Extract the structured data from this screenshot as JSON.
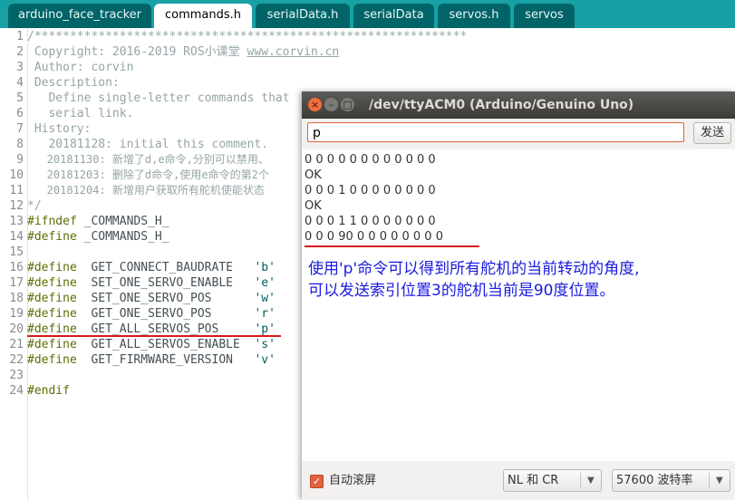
{
  "tabs": [
    "arduino_face_tracker",
    "commands.h",
    "serialData.h",
    "serialData",
    "servos.h",
    "servos"
  ],
  "active_tab": 1,
  "editor": {
    "line_numbers": [
      "1",
      "2",
      "3",
      "4",
      "5",
      "6",
      "7",
      "8",
      "9",
      "10",
      "11",
      "12",
      "13",
      "14",
      "15",
      "16",
      "17",
      "18",
      "19",
      "20",
      "21",
      "22",
      "23",
      "24"
    ],
    "line1": "/*************************************************************",
    "line2_text": " Copyright: 2016-2019 ROS小课堂 ",
    "line2_link": "www.corvin.cn",
    "line3": " Author: corvin",
    "line4": " Description:",
    "line5": "   Define single-letter commands that",
    "line6": "   serial link.",
    "line7": " History:",
    "line8": "   20181128: initial this comment.",
    "line9": "   20181130: 新增了d,e命令,分别可以禁用、",
    "line10": "   20181203: 删除了d命令,使用e命令的第2个",
    "line11": "   20181204: 新增用户获取所有舵机使能状态",
    "line12": "*/",
    "line13_kw": "#ifndef",
    "line13_name": " _COMMANDS_H_",
    "line14_kw": "#define",
    "line14_name": " _COMMANDS_H_",
    "line24_kw": "#endif",
    "defines": [
      {
        "kw": "#define",
        "name": "  GET_CONNECT_BAUDRATE   ",
        "ch": "'b'"
      },
      {
        "kw": "#define",
        "name": "  SET_ONE_SERVO_ENABLE   ",
        "ch": "'e'"
      },
      {
        "kw": "#define",
        "name": "  SET_ONE_SERVO_POS      ",
        "ch": "'w'"
      },
      {
        "kw": "#define",
        "name": "  GET_ONE_SERVO_POS      ",
        "ch": "'r'"
      },
      {
        "kw": "#define",
        "name": "  GET_ALL_SERVOS_POS     ",
        "ch": "'p'"
      },
      {
        "kw": "#define",
        "name": "  GET_ALL_SERVOS_ENABLE  ",
        "ch": "'s'"
      },
      {
        "kw": "#define",
        "name": "  GET_FIRMWARE_VERSION   ",
        "ch": "'v'"
      }
    ]
  },
  "serial": {
    "title": "/dev/ttyACM0 (Arduino/Genuino Uno)",
    "close_glyph": "×",
    "min_glyph": "–",
    "max_glyph": "□",
    "input_value": "p",
    "send_label": "发送",
    "output_lines": [
      "0 0 0 0 0 0 0 0 0 0 0 0",
      "OK",
      "0 0 0 1 0 0 0 0 0 0 0 0",
      "OK",
      "0 0 0 1 1 0 0 0 0 0 0 0",
      "0 0 0 90 0 0 0 0 0 0 0 0"
    ],
    "annotation_line1": "使用'p'命令可以得到所有舵机的当前转动的角度,",
    "annotation_line2": "可以发送索引位置3的舵机当前是90度位置。",
    "autoscroll_label": "自动滚屏",
    "autoscroll_checked": true,
    "line_ending": "NL 和 CR",
    "baud_rate": "57600 波特率"
  },
  "colors": {
    "tab_bar": "#17a1a5",
    "tab_inactive": "#006468",
    "comment": "#95a5a6",
    "keyword": "#5e6d03",
    "char_literal": "#005c5f",
    "annotation": "#1a1ae0",
    "underline_mark": "#d61a1a",
    "accent": "#e0623e"
  }
}
